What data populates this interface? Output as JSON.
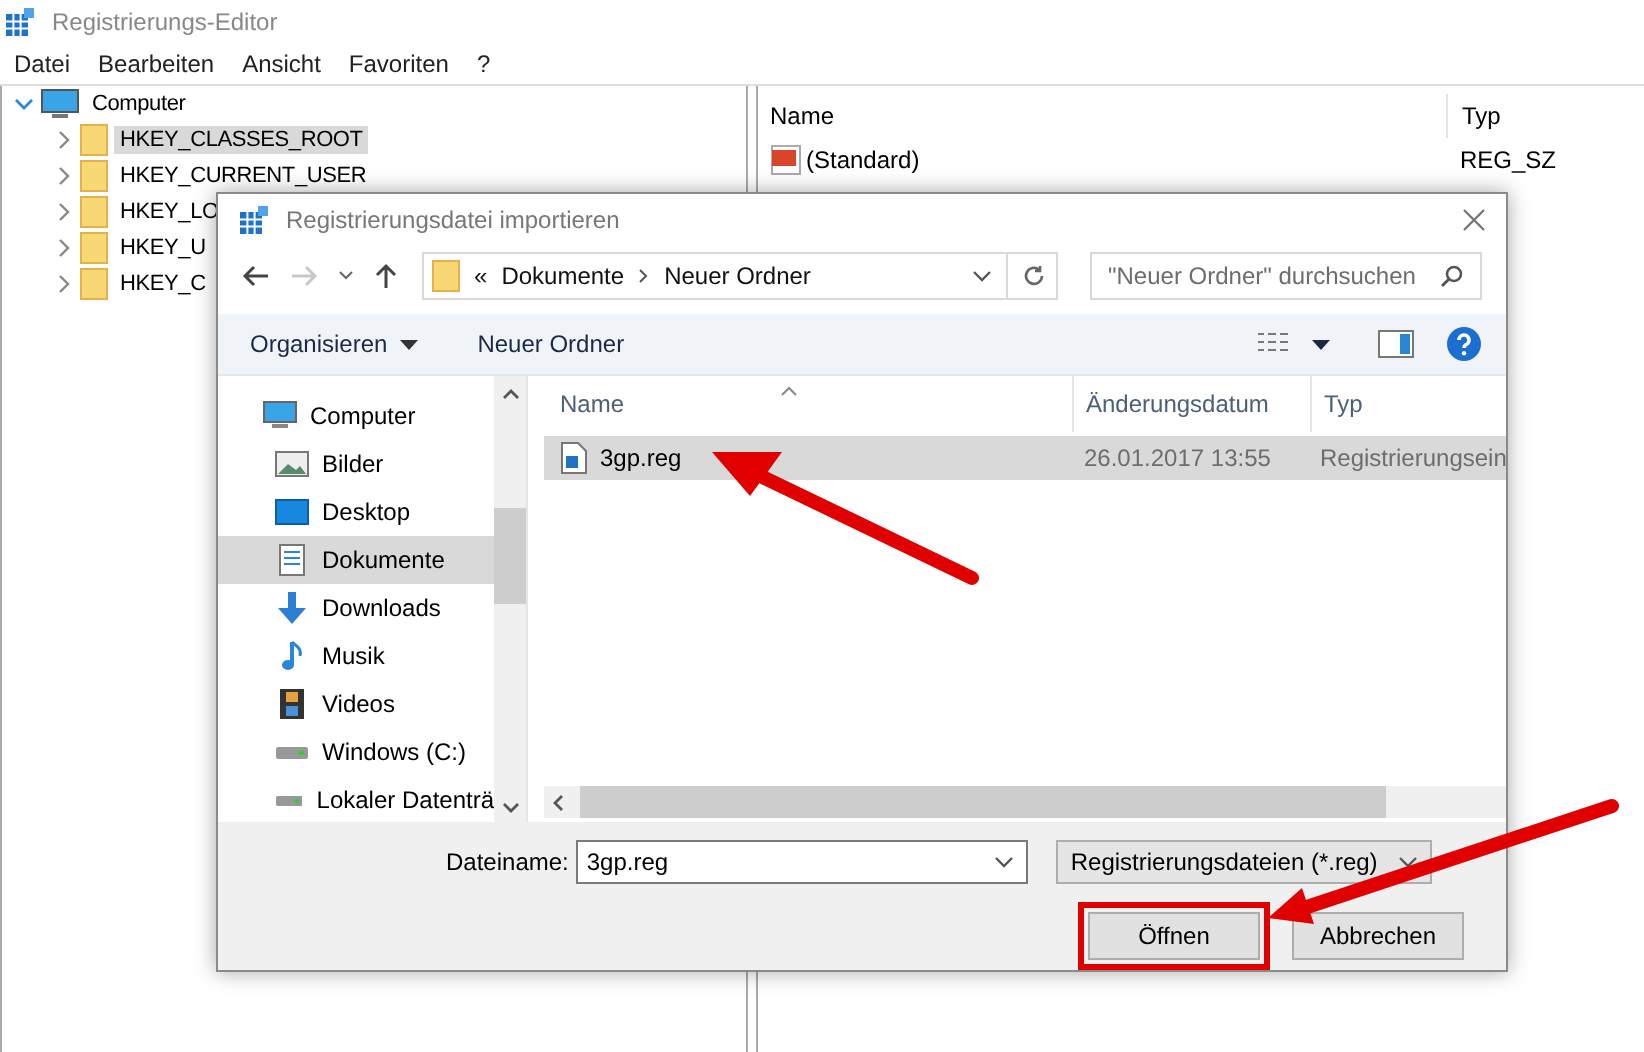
{
  "window": {
    "title": "Registrierungs-Editor"
  },
  "menu": [
    "Datei",
    "Bearbeiten",
    "Ansicht",
    "Favoriten",
    "?"
  ],
  "tree": {
    "label": "Computer",
    "expanded": true,
    "children": [
      {
        "label": "HKEY_CLASSES_ROOT",
        "selected": true
      },
      {
        "label": "HKEY_CURRENT_USER",
        "selected": false
      },
      {
        "label": "HKEY_LO",
        "selected": false
      },
      {
        "label": "HKEY_U",
        "selected": false
      },
      {
        "label": "HKEY_C",
        "selected": false
      }
    ]
  },
  "values_table": {
    "columns": [
      "Name",
      "Typ"
    ],
    "rows": [
      {
        "name": "(Standard)",
        "type": "REG_SZ"
      }
    ]
  },
  "dialog": {
    "title": "Registrierungsdatei importieren",
    "forward_disabled": true,
    "address": {
      "overflow": "«",
      "path": [
        "Dokumente",
        "Neuer Ordner"
      ]
    },
    "search": {
      "placeholder": "\"Neuer Ordner\" durchsuchen"
    },
    "toolbar": [
      {
        "label": "Organisieren",
        "kind": "menu"
      },
      {
        "label": "Neuer Ordner",
        "kind": "button"
      }
    ],
    "nav": [
      {
        "label": "Computer",
        "kind": "computer",
        "selected": false
      },
      {
        "label": "Bilder",
        "kind": "pictures",
        "selected": false
      },
      {
        "label": "Desktop",
        "kind": "desktop",
        "selected": false
      },
      {
        "label": "Dokumente",
        "kind": "documents",
        "selected": true
      },
      {
        "label": "Downloads",
        "kind": "downloads",
        "selected": false
      },
      {
        "label": "Musik",
        "kind": "music",
        "selected": false
      },
      {
        "label": "Videos",
        "kind": "videos",
        "selected": false
      },
      {
        "label": "Windows (C:)",
        "kind": "drive",
        "selected": false
      },
      {
        "label": "Lokaler Datenträ",
        "kind": "drive",
        "selected": false
      }
    ],
    "columns": [
      "Name",
      "Änderungsdatum",
      "Typ"
    ],
    "files": [
      {
        "name": "3gp.reg",
        "date": "26.01.2017 13:55",
        "type": "Registrierungsein",
        "selected": true
      }
    ],
    "filename": {
      "label": "Dateiname:",
      "value": "3gp.reg"
    },
    "filetype": {
      "value": "Registrierungsdateien (*.reg)"
    },
    "buttons": [
      {
        "label": "Öffnen",
        "highlighted": true
      },
      {
        "label": "Abbrechen",
        "highlighted": false
      }
    ]
  }
}
